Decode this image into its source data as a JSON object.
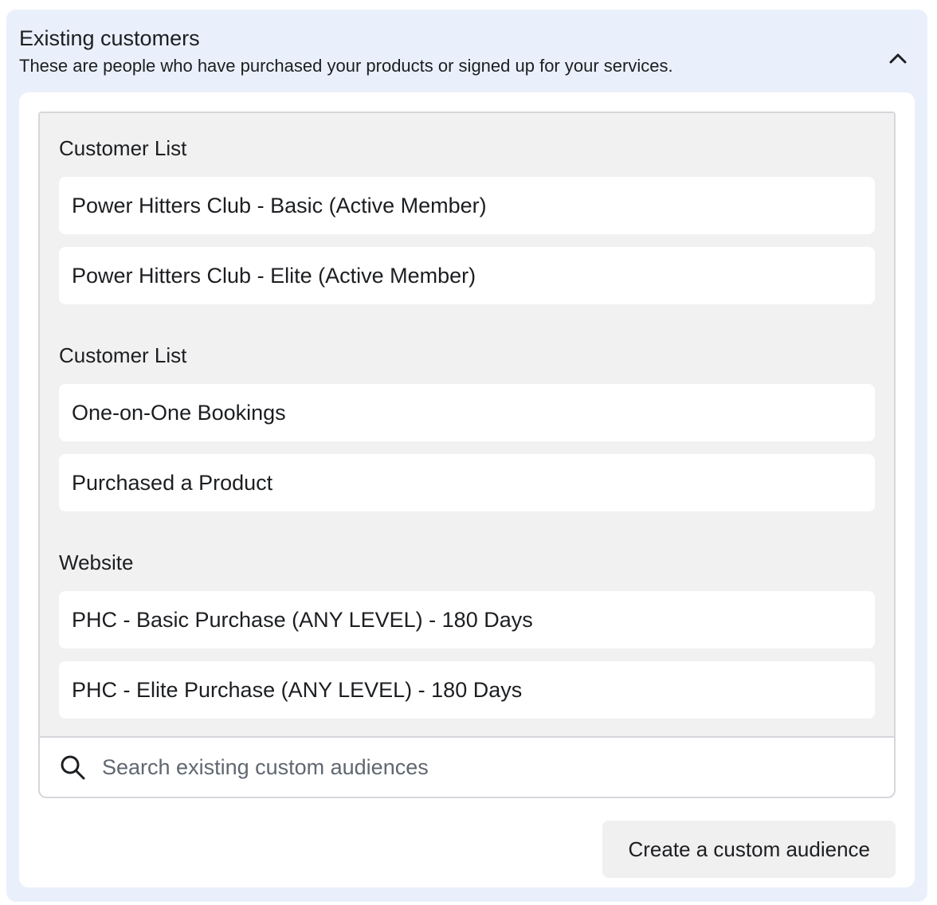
{
  "section": {
    "title": "Existing customers",
    "subtitle": "These are people who have purchased your products or signed up for your services.",
    "collapse_icon": "chevron-up-icon"
  },
  "groups": [
    {
      "label": "Customer List",
      "items": [
        "Power Hitters Club - Basic (Active Member)",
        "Power Hitters Club - Elite (Active Member)"
      ]
    },
    {
      "label": "Customer List",
      "items": [
        "One-on-One Bookings",
        "Purchased a Product"
      ]
    },
    {
      "label": "Website",
      "items": [
        "PHC - Basic Purchase (ANY LEVEL) - 180 Days",
        "PHC - Elite Purchase (ANY LEVEL) - 180 Days"
      ]
    }
  ],
  "search": {
    "placeholder": "Search existing custom audiences",
    "value": "",
    "icon": "search-icon"
  },
  "actions": {
    "create_label": "Create a custom audience"
  }
}
